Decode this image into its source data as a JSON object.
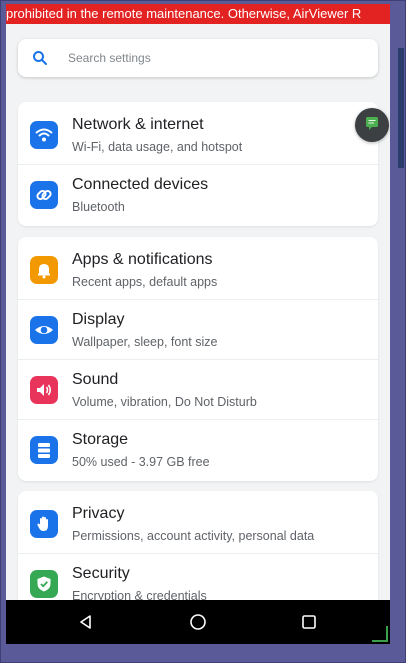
{
  "banner": {
    "text": "prohibited in the remote maintenance. Otherwise, AirViewer R"
  },
  "search": {
    "placeholder": "Search settings",
    "icon": "search-icon"
  },
  "colors": {
    "wifi": "#1a73e8",
    "connected": "#1a73e8",
    "apps": "#f29900",
    "display": "#1a73e8",
    "sound": "#e8335a",
    "storage": "#1a73e8",
    "privacy": "#1a73e8",
    "security": "#34a853"
  },
  "groups": [
    {
      "items": [
        {
          "title": "Network & internet",
          "subtitle": "Wi-Fi, data usage, and hotspot",
          "icon": "wifi-icon"
        },
        {
          "title": "Connected devices",
          "subtitle": "Bluetooth",
          "icon": "link-icon"
        }
      ]
    },
    {
      "items": [
        {
          "title": "Apps & notifications",
          "subtitle": "Recent apps, default apps",
          "icon": "bell-icon"
        },
        {
          "title": "Display",
          "subtitle": "Wallpaper, sleep, font size",
          "icon": "eye-icon"
        },
        {
          "title": "Sound",
          "subtitle": "Volume, vibration, Do Not Disturb",
          "icon": "speaker-icon"
        },
        {
          "title": "Storage",
          "subtitle": "50% used - 3.97 GB free",
          "icon": "storage-icon"
        }
      ]
    },
    {
      "items": [
        {
          "title": "Privacy",
          "subtitle": "Permissions, account activity, personal data",
          "icon": "hand-icon"
        },
        {
          "title": "Security",
          "subtitle": "Encryption & credentials",
          "icon": "shield-icon"
        }
      ]
    }
  ],
  "navbar": {
    "back": "back-icon",
    "home": "home-icon",
    "recents": "recents-icon"
  }
}
